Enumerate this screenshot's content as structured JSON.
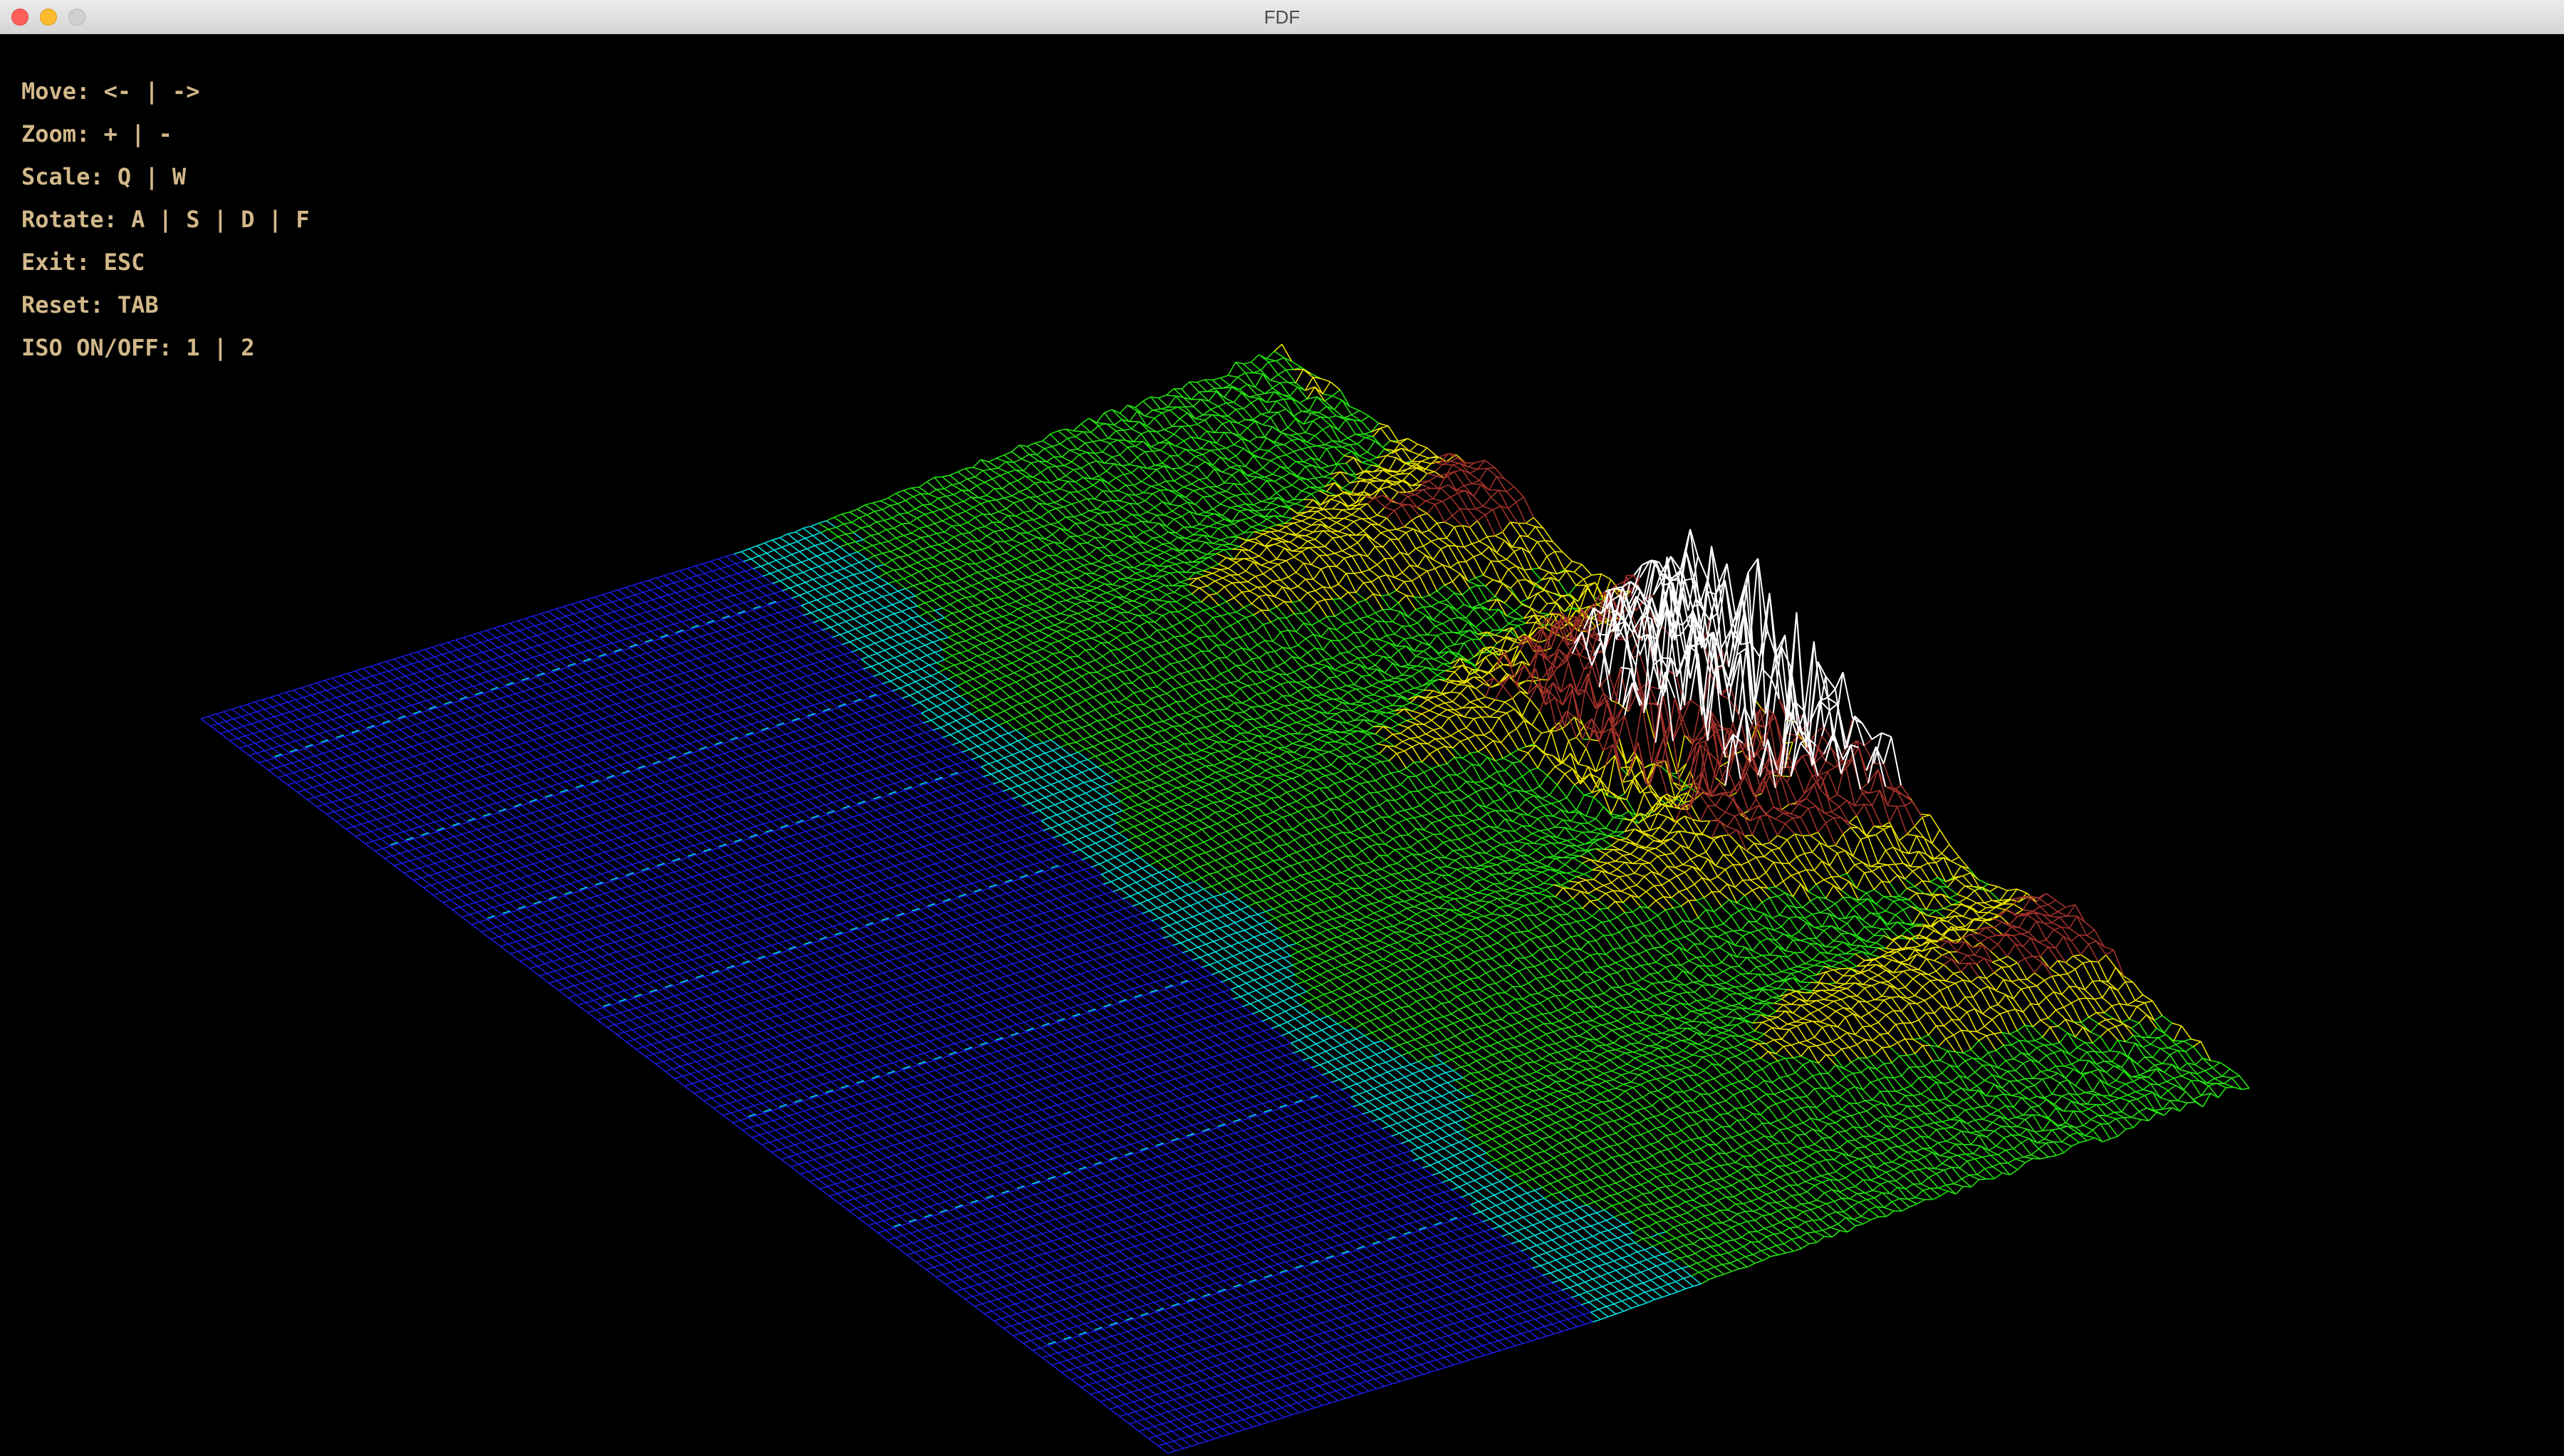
{
  "window": {
    "title": "FDF"
  },
  "controls": [
    "Move: <- | ->",
    "Zoom: + | -",
    "Scale: Q | W",
    "Rotate: A | S | D | F",
    "Exit: ESC",
    "Reset: TAB",
    "ISO ON/OFF: 1 | 2"
  ],
  "colors": {
    "background": "#000000",
    "low": "#1a1adc",
    "shore": "#00e0e0",
    "mid": "#22e010",
    "sand": "#e8e000",
    "high": "#a0302a",
    "peak": "#ffffff",
    "controls_text": "#d2b88a"
  }
}
